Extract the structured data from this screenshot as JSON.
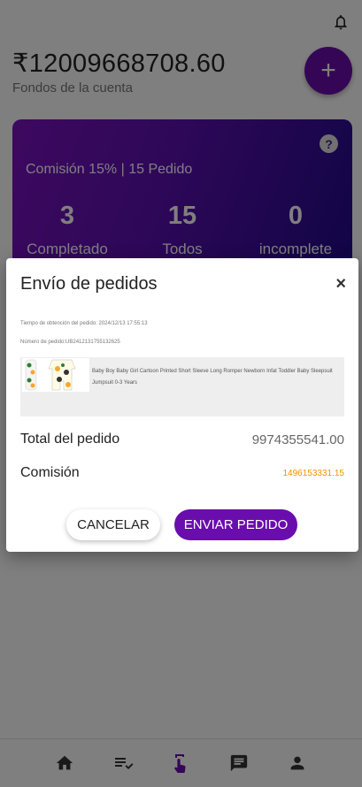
{
  "header": {
    "balance": "₹12009668708.60",
    "balance_label": "Fondos de la cuenta",
    "fab_label": "+"
  },
  "summary_card": {
    "help_label": "?",
    "commission_text": "Comisión 15% | 15 Pedido",
    "stats": [
      {
        "value": "3",
        "label": "Completado"
      },
      {
        "value": "15",
        "label": "Todos"
      },
      {
        "value": "0",
        "label": "incomplete"
      }
    ]
  },
  "dialog": {
    "title": "Envío de pedidos",
    "close_label": "×",
    "order_time": "Tiempo de obtención del pedido:  2024/12/13 17:55:13",
    "order_number": "Número de pedido:UB2412131755132625",
    "product_name": "Baby Boy Baby Girl Cartoon Printed Short Sleeve Long Romper Newborn Infat Toddler Baby Sleepsuit Jumpsuit 0-3 Years",
    "total_label": "Total del pedido",
    "total_value": "9974355541.00",
    "commission_label": "Comisión",
    "commission_value": "1496153331.15",
    "cancel_label": "CANCELAR",
    "send_label": "ENVIAR PEDIDO"
  },
  "bottom_nav": [
    {
      "icon": "home-icon"
    },
    {
      "icon": "task-list-icon"
    },
    {
      "icon": "tap-icon"
    },
    {
      "icon": "chat-icon"
    },
    {
      "icon": "person-icon"
    }
  ],
  "colors": {
    "accent": "#6a0dad",
    "card_gradient_start": "#7b12c0",
    "card_gradient_end": "#1f0a8a",
    "commission_value": "#f39200"
  }
}
